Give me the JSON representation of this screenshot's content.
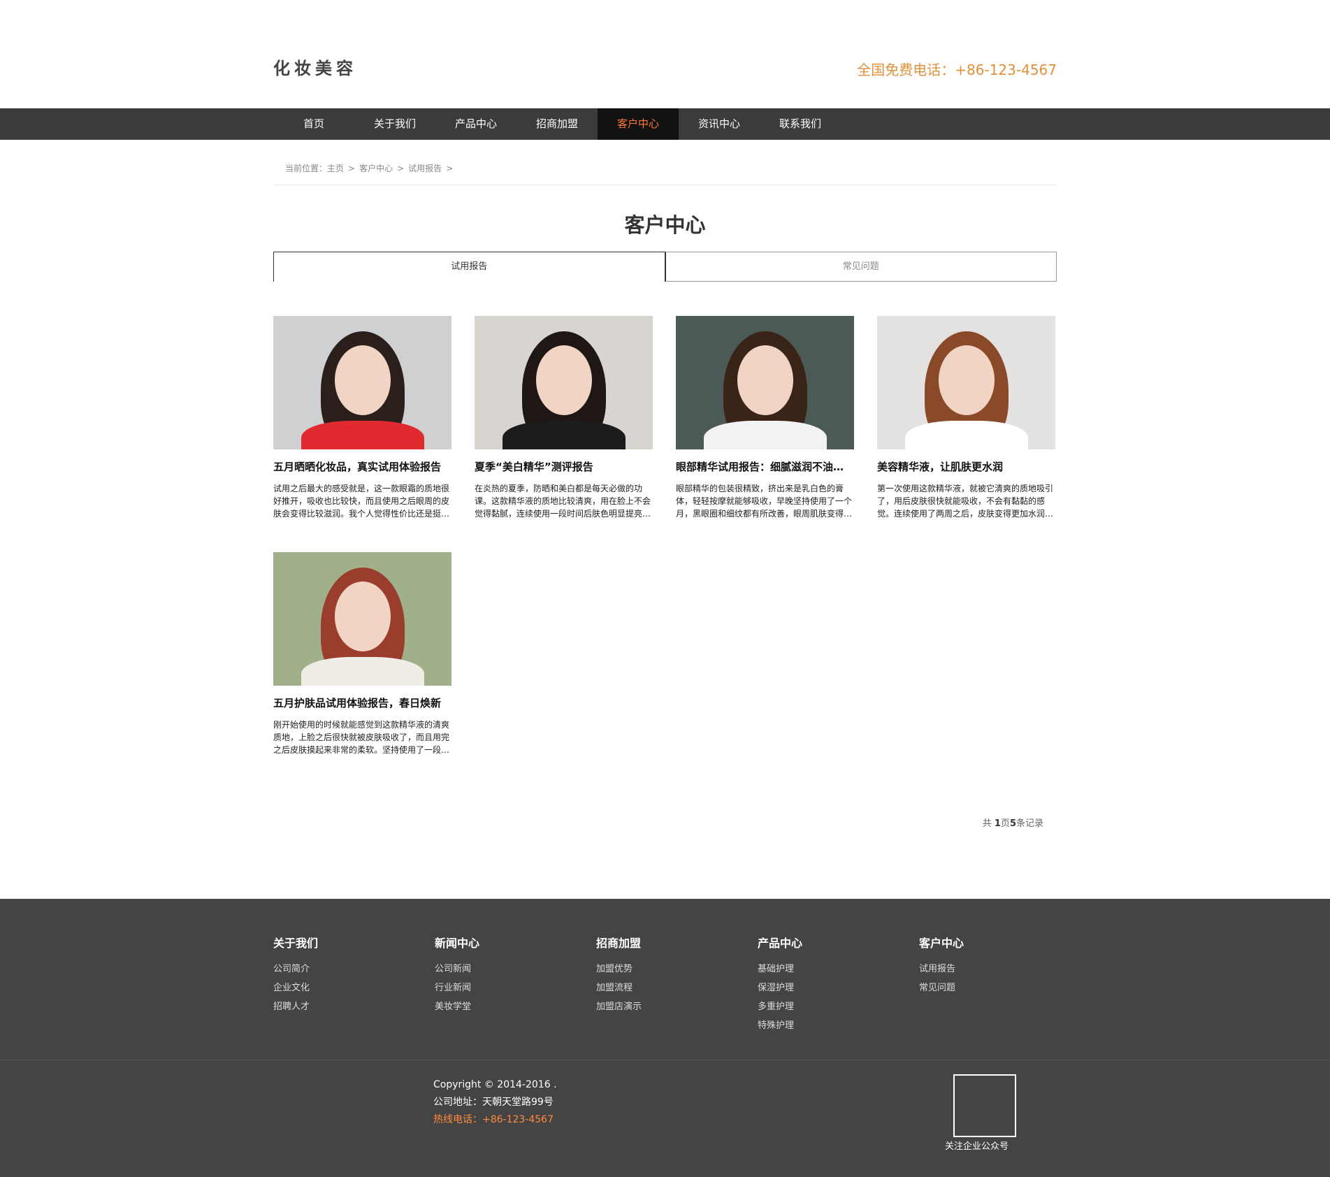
{
  "header": {
    "logo": "化妆美容",
    "hotline": "全国免费电话：+86-123-4567"
  },
  "nav": {
    "items": [
      "首页",
      "关于我们",
      "产品中心",
      "招商加盟",
      "客户中心",
      "资讯中心",
      "联系我们"
    ],
    "active_index": 4
  },
  "breadcrumb": {
    "prefix": "当前位置：",
    "items": [
      "主页",
      "客户中心",
      "试用报告"
    ],
    "separator": ">"
  },
  "page_title": "客户中心",
  "tabs": [
    {
      "label": "试用报告",
      "active": true
    },
    {
      "label": "常见问题",
      "active": false
    }
  ],
  "cards": [
    {
      "title": "五月晒晒化妆品，真实试用体验报告",
      "desc": "试用之后最大的感受就是，这一款眼霜的质地很好推开，吸收也比较快，而且使用之后眼周的皮肤会变得比较滋润。我个人觉得性价比还是挺高的，值得推荐……",
      "bg": "#cfd0d2",
      "shirt": "#e02a2f",
      "hair": "#2a1f1b"
    },
    {
      "title": "夏季“美白精华”测评报告",
      "desc": "在炎热的夏季，防晒和美白都是每天必做的功课。这款精华液的质地比较清爽，用在脸上不会觉得黏腻，连续使用一段时间后肤色明显提亮了，整体……",
      "bg": "#d8d4cf",
      "shirt": "#1c1c1c",
      "hair": "#1f1714"
    },
    {
      "title": "眼部精华试用报告：细腻滋润不油腻，效果明显",
      "desc": "眼部精华的包装很精致，挤出来是乳白色的膏体，轻轻按摩就能够吸收，早晚坚持使用了一个月，黑眼圈和细纹都有所改善，眼周肌肤变得更加紧致有弹性，推荐给大家……",
      "bg": "#4b5a55",
      "shirt": "#f2f2f2",
      "hair": "#3a2418"
    },
    {
      "title": "美容精华液，让肌肤更水润",
      "desc": "第一次使用这款精华液，就被它清爽的质地吸引了，用后皮肤很快就能吸收，不会有黏黏的感觉。连续使用了两周之后，皮肤变得更加水润有光泽，整体状态……",
      "bg": "#e4e2e0",
      "shirt": "#ffffff",
      "hair": "#8a4a2a"
    },
    {
      "title": "五月护肤品试用体验报告，春日焕新",
      "desc": "刚开始使用的时候就能感觉到这款精华液的清爽质地，上脸之后很快就被皮肤吸收了，而且用完之后皮肤摸起来非常的柔软。坚持使用了一段时间，肤色也变得更加均匀透亮，值得推荐……",
      "bg": "#9fb08a",
      "shirt": "#f0ece6",
      "hair": "#9a3d2c"
    }
  ],
  "pager": {
    "prefix": "共 ",
    "pages": "1",
    "mid": "页",
    "records": "5",
    "suffix": "条记录"
  },
  "footer": {
    "columns": [
      {
        "title": "关于我们",
        "links": [
          "公司简介",
          "企业文化",
          "招聘人才"
        ]
      },
      {
        "title": "新闻中心",
        "links": [
          "公司新闻",
          "行业新闻",
          "美妆学堂"
        ]
      },
      {
        "title": "招商加盟",
        "links": [
          "加盟优势",
          "加盟流程",
          "加盟店演示"
        ]
      },
      {
        "title": "产品中心",
        "links": [
          "基础护理",
          "保湿护理",
          "多重护理",
          "特殊护理"
        ]
      },
      {
        "title": "客户中心",
        "links": [
          "试用报告",
          "常见问题"
        ]
      }
    ],
    "copyright": "Copyright © 2014-2016 .",
    "address": "公司地址：天朝天堂路99号",
    "hotline": "热线电话：+86-123-4567",
    "qr_label": "关注企业公众号"
  },
  "colors": {
    "accent": "#ff7a2e",
    "hotline": "#e0913a",
    "nav_bg": "#3b3b3b",
    "footer_bg": "#444444"
  }
}
